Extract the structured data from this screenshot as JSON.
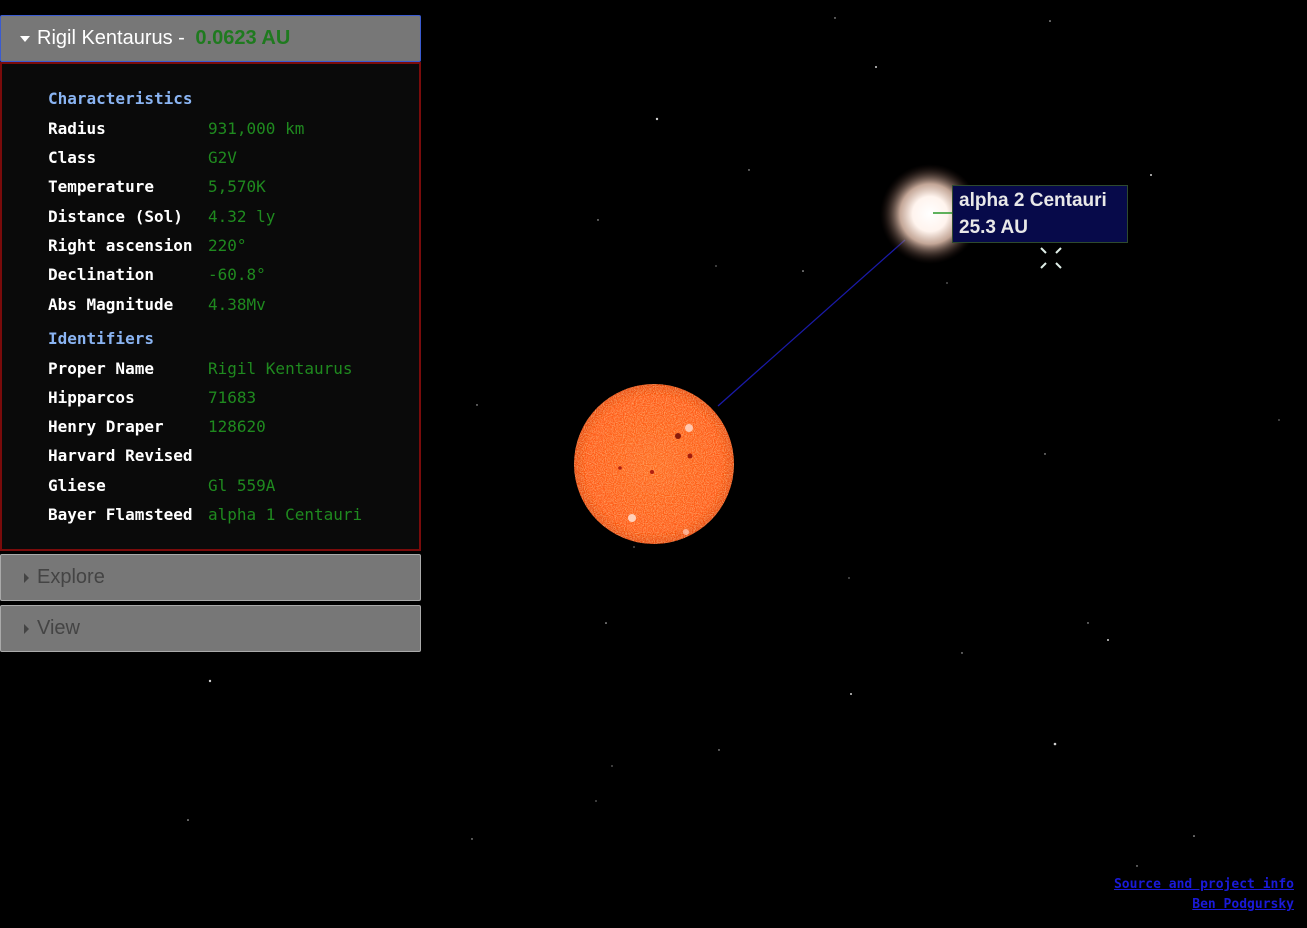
{
  "main_panel": {
    "star_name": "Rigil Kentaurus",
    "separator": " - ",
    "distance": "0.0623 AU",
    "characteristics_title": "Characteristics",
    "characteristics": [
      {
        "key": "Radius",
        "value": "931,000 km"
      },
      {
        "key": "Class",
        "value": "G2V"
      },
      {
        "key": "Temperature",
        "value": "5,570K"
      },
      {
        "key": "Distance (Sol)",
        "value": "4.32 ly"
      },
      {
        "key": "Right ascension",
        "value": "220°"
      },
      {
        "key": "Declination",
        "value": "-60.8°"
      },
      {
        "key": "Abs Magnitude",
        "value": "4.38Mv"
      }
    ],
    "identifiers_title": "Identifiers",
    "identifiers": [
      {
        "key": "Proper Name",
        "value": "Rigil Kentaurus"
      },
      {
        "key": "Hipparcos",
        "value": "71683"
      },
      {
        "key": "Henry Draper",
        "value": "128620"
      },
      {
        "key": "Harvard Revised",
        "value": ""
      },
      {
        "key": "Gliese",
        "value": "Gl 559A"
      },
      {
        "key": "Bayer Flamsteed",
        "value": "alpha 1 Centauri"
      }
    ]
  },
  "explore_panel": {
    "label": "Explore"
  },
  "view_panel": {
    "label": "View"
  },
  "companion_label": {
    "name": "alpha 2 Centauri",
    "distance": "25.3 AU"
  },
  "footer": {
    "source_link": "Source and project info",
    "author_link": "Ben Podgursky"
  },
  "colors": {
    "background": "#000000",
    "panel_header": "#777777",
    "value_green": "#1f8a1f",
    "section_blue": "#8ab4f2",
    "label_box": "#070a4a",
    "link_blue": "#1a1ad8"
  }
}
